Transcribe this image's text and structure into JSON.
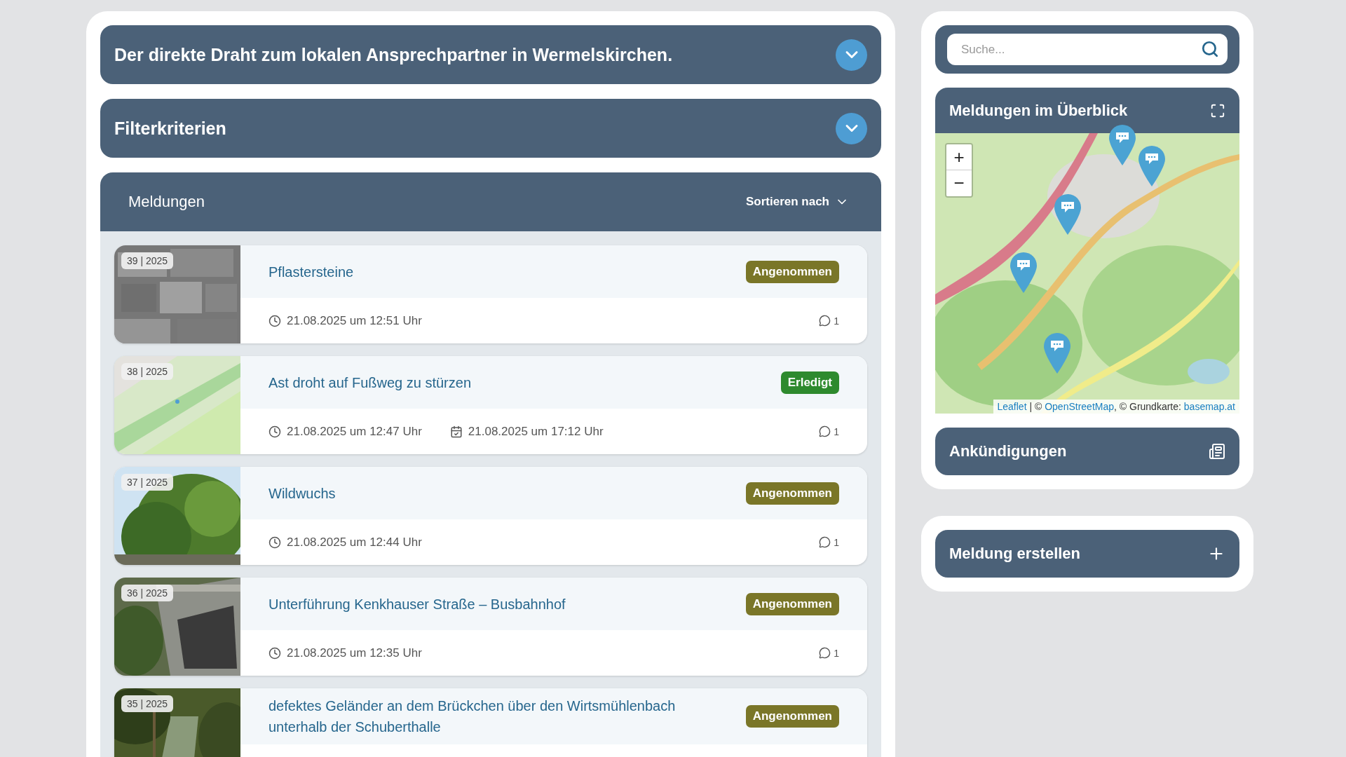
{
  "intro": {
    "title": "Der direkte Draht zum lokalen Ansprechpartner in Wermelskirchen.",
    "expanded": false
  },
  "filter": {
    "title": "Filterkriterien",
    "expanded": false
  },
  "reports": {
    "title": "Meldungen",
    "sort_label": "Sortieren nach",
    "items": [
      {
        "number": "39 | 2025",
        "title": "Pflastersteine",
        "status": "Angenommen",
        "color": "#7a7628",
        "created": "21.08.2025 um 12:51 Uhr",
        "comments": "1",
        "kind": "picture"
      },
      {
        "number": "38 | 2025",
        "title": "Ast droht auf Fußweg zu stürzen",
        "status": "Erledigt",
        "color": "#2e8a2e",
        "created": "21.08.2025 um 12:47 Uhr",
        "done": "21.08.2025 um 17:12 Uhr",
        "comments": "1",
        "kind": "picture"
      },
      {
        "number": "37 | 2025",
        "title": "Wildwuchs",
        "status": "Angenommen",
        "color": "#7a7628",
        "created": "21.08.2025 um 12:44 Uhr",
        "comments": "1",
        "kind": "picture"
      },
      {
        "number": "36 | 2025",
        "title": "Unterführung Kenkhauser Straße – Busbahnhof",
        "status": "Angenommen",
        "color": "#7a7628",
        "created": "21.08.2025 um 12:35 Uhr",
        "comments": "1",
        "kind": "picture"
      },
      {
        "number": "35 | 2025",
        "title": "defektes Geländer an dem Brückchen über den Wirtsmühlenbach unterhalb der Schuberthalle",
        "status": "Angenommen",
        "color": "#7a7628",
        "kind": "picture"
      }
    ]
  },
  "search": {
    "placeholder": "Suche..."
  },
  "map": {
    "title": "Meldungen im Überblick",
    "zoom_in": "+",
    "zoom_out": "−",
    "attribution": [
      {
        "kind": "link",
        "text": "Leaflet"
      },
      {
        "kind": "text",
        "text": " | © "
      },
      {
        "kind": "link",
        "text": "OpenStreetMap"
      },
      {
        "kind": "text",
        "text": ", © Grundkarte: "
      },
      {
        "kind": "link",
        "text": "basemap.at"
      }
    ]
  },
  "announcements": {
    "title": "Ankündigungen"
  },
  "create": {
    "title": "Meldung erstellen"
  }
}
